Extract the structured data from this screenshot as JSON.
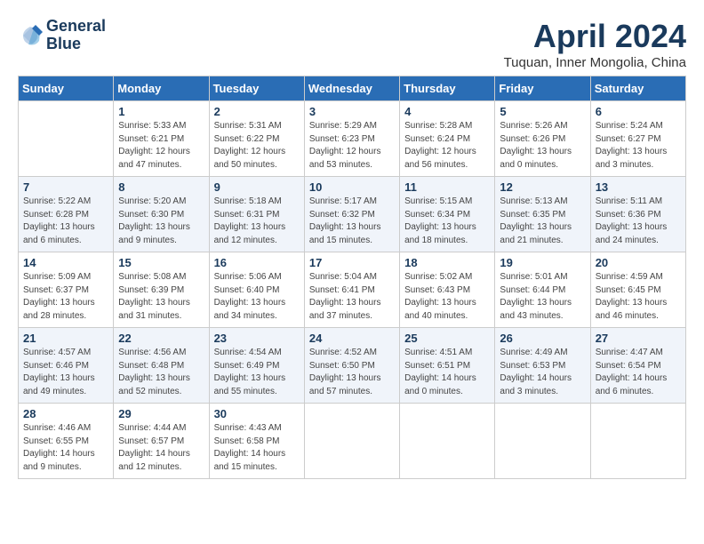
{
  "header": {
    "logo_line1": "General",
    "logo_line2": "Blue",
    "month": "April 2024",
    "location": "Tuquan, Inner Mongolia, China"
  },
  "days_of_week": [
    "Sunday",
    "Monday",
    "Tuesday",
    "Wednesday",
    "Thursday",
    "Friday",
    "Saturday"
  ],
  "weeks": [
    [
      {
        "day": "",
        "text": ""
      },
      {
        "day": "1",
        "text": "Sunrise: 5:33 AM\nSunset: 6:21 PM\nDaylight: 12 hours\nand 47 minutes."
      },
      {
        "day": "2",
        "text": "Sunrise: 5:31 AM\nSunset: 6:22 PM\nDaylight: 12 hours\nand 50 minutes."
      },
      {
        "day": "3",
        "text": "Sunrise: 5:29 AM\nSunset: 6:23 PM\nDaylight: 12 hours\nand 53 minutes."
      },
      {
        "day": "4",
        "text": "Sunrise: 5:28 AM\nSunset: 6:24 PM\nDaylight: 12 hours\nand 56 minutes."
      },
      {
        "day": "5",
        "text": "Sunrise: 5:26 AM\nSunset: 6:26 PM\nDaylight: 13 hours\nand 0 minutes."
      },
      {
        "day": "6",
        "text": "Sunrise: 5:24 AM\nSunset: 6:27 PM\nDaylight: 13 hours\nand 3 minutes."
      }
    ],
    [
      {
        "day": "7",
        "text": "Sunrise: 5:22 AM\nSunset: 6:28 PM\nDaylight: 13 hours\nand 6 minutes."
      },
      {
        "day": "8",
        "text": "Sunrise: 5:20 AM\nSunset: 6:30 PM\nDaylight: 13 hours\nand 9 minutes."
      },
      {
        "day": "9",
        "text": "Sunrise: 5:18 AM\nSunset: 6:31 PM\nDaylight: 13 hours\nand 12 minutes."
      },
      {
        "day": "10",
        "text": "Sunrise: 5:17 AM\nSunset: 6:32 PM\nDaylight: 13 hours\nand 15 minutes."
      },
      {
        "day": "11",
        "text": "Sunrise: 5:15 AM\nSunset: 6:34 PM\nDaylight: 13 hours\nand 18 minutes."
      },
      {
        "day": "12",
        "text": "Sunrise: 5:13 AM\nSunset: 6:35 PM\nDaylight: 13 hours\nand 21 minutes."
      },
      {
        "day": "13",
        "text": "Sunrise: 5:11 AM\nSunset: 6:36 PM\nDaylight: 13 hours\nand 24 minutes."
      }
    ],
    [
      {
        "day": "14",
        "text": "Sunrise: 5:09 AM\nSunset: 6:37 PM\nDaylight: 13 hours\nand 28 minutes."
      },
      {
        "day": "15",
        "text": "Sunrise: 5:08 AM\nSunset: 6:39 PM\nDaylight: 13 hours\nand 31 minutes."
      },
      {
        "day": "16",
        "text": "Sunrise: 5:06 AM\nSunset: 6:40 PM\nDaylight: 13 hours\nand 34 minutes."
      },
      {
        "day": "17",
        "text": "Sunrise: 5:04 AM\nSunset: 6:41 PM\nDaylight: 13 hours\nand 37 minutes."
      },
      {
        "day": "18",
        "text": "Sunrise: 5:02 AM\nSunset: 6:43 PM\nDaylight: 13 hours\nand 40 minutes."
      },
      {
        "day": "19",
        "text": "Sunrise: 5:01 AM\nSunset: 6:44 PM\nDaylight: 13 hours\nand 43 minutes."
      },
      {
        "day": "20",
        "text": "Sunrise: 4:59 AM\nSunset: 6:45 PM\nDaylight: 13 hours\nand 46 minutes."
      }
    ],
    [
      {
        "day": "21",
        "text": "Sunrise: 4:57 AM\nSunset: 6:46 PM\nDaylight: 13 hours\nand 49 minutes."
      },
      {
        "day": "22",
        "text": "Sunrise: 4:56 AM\nSunset: 6:48 PM\nDaylight: 13 hours\nand 52 minutes."
      },
      {
        "day": "23",
        "text": "Sunrise: 4:54 AM\nSunset: 6:49 PM\nDaylight: 13 hours\nand 55 minutes."
      },
      {
        "day": "24",
        "text": "Sunrise: 4:52 AM\nSunset: 6:50 PM\nDaylight: 13 hours\nand 57 minutes."
      },
      {
        "day": "25",
        "text": "Sunrise: 4:51 AM\nSunset: 6:51 PM\nDaylight: 14 hours\nand 0 minutes."
      },
      {
        "day": "26",
        "text": "Sunrise: 4:49 AM\nSunset: 6:53 PM\nDaylight: 14 hours\nand 3 minutes."
      },
      {
        "day": "27",
        "text": "Sunrise: 4:47 AM\nSunset: 6:54 PM\nDaylight: 14 hours\nand 6 minutes."
      }
    ],
    [
      {
        "day": "28",
        "text": "Sunrise: 4:46 AM\nSunset: 6:55 PM\nDaylight: 14 hours\nand 9 minutes."
      },
      {
        "day": "29",
        "text": "Sunrise: 4:44 AM\nSunset: 6:57 PM\nDaylight: 14 hours\nand 12 minutes."
      },
      {
        "day": "30",
        "text": "Sunrise: 4:43 AM\nSunset: 6:58 PM\nDaylight: 14 hours\nand 15 minutes."
      },
      {
        "day": "",
        "text": ""
      },
      {
        "day": "",
        "text": ""
      },
      {
        "day": "",
        "text": ""
      },
      {
        "day": "",
        "text": ""
      }
    ]
  ]
}
